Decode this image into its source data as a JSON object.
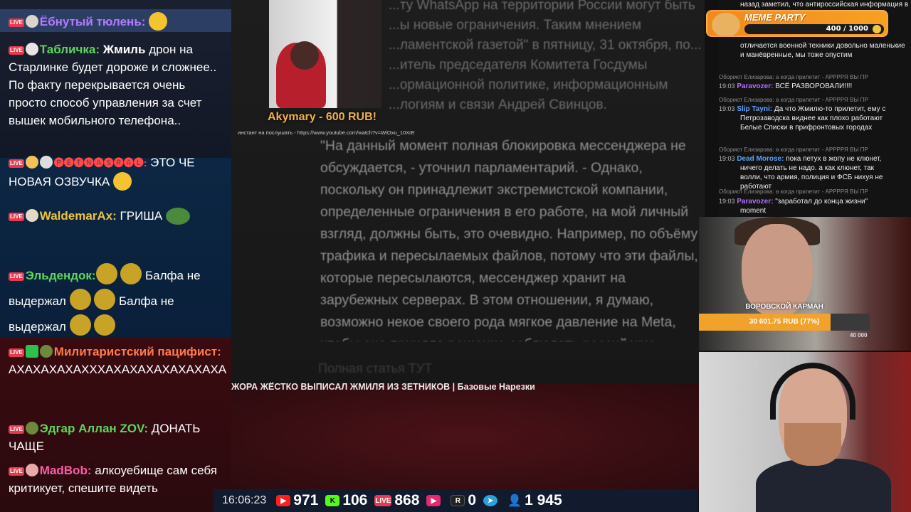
{
  "article": {
    "intro": "...ту WhatsApp на территории России могут быть ...ы новые ограничения. Таким мнением ...ламентской газетой\" в пятницу, 31 октября, по... ...итель председателя Комитета Госдумы ...ормационной политике, информационным ...логиям и связи Андрей Свинцов.",
    "quote": "\"На данный момент полная блокировка мессенджера не обсуждается, - уточнил парламентарий. - Однако, поскольку он принадлежит экстремистской компании, определенные ограничения в его работе, на мой личный взгляд, должны быть, это очевидно. Например, по объёму трафика и пересылаемых файлов, потому что эти файлы, которые пересылаются, мессенджер хранит на зарубежных серверах. В этом отношении, я думаю, возможно некое своего рода мягкое давление на Meta, чтобы она приняла решение соблюдать российские законы",
    "full_link": "Полная статья ТУТ"
  },
  "donation": {
    "title": "Akymary - 600 RUB!",
    "link": "инстант на послушать - https://www.youtube.com/watch?v=WiOxu_10XrE"
  },
  "chat": [
    {
      "nick": "Ёбнутый тюлень:",
      "text": "",
      "color": "#b47aff"
    },
    {
      "nick": "Табличка:",
      "text": " Жмиль дрон на Старлинке будет дороже и сложнее.. По факту перекрывается очень просто способ управления за счет вышек мобильного телефона..",
      "bold_prefix": "Жмиль",
      "color": "#5cd65c"
    },
    {
      "nick": "🅟🅔🅣🅝🅐🅢🅡🅐🅛:",
      "text": " ЭТО ЧЕ НОВАЯ ОЗВУЧКА",
      "color": "#ff4a4a"
    },
    {
      "nick": "WaldemarAx:",
      "text": " ГРИША",
      "color": "#f0c33c"
    },
    {
      "nick": "Эльдендок:",
      "text": " Балфа не выдержал  Балфа не выдержал",
      "color": "#5cd65c"
    },
    {
      "nick": "Милитаристский пацифист:",
      "text": " АХАХАХАХАХХХАХАХАХАХАХАХАХА",
      "color": "#ff7b4a"
    },
    {
      "nick": "Эдгар Аллан ZOV:",
      "text": " ДОНАТЬ ЧАЩЕ",
      "color": "#5cd65c"
    },
    {
      "nick": "MadBob:",
      "text": " алкоуебище сам себя критикует, спешите видеть",
      "color": "#ff5ca8"
    }
  ],
  "banner": {
    "title": "ЖОРА ЖЁСТКО ВЫПИСАЛ ЖМИЛЯ ИЗ ЗЕТНИКОВ | Базовые Нарезки"
  },
  "stats": {
    "time": "16:06:23",
    "youtube": "971",
    "kick": "106",
    "vk": "868",
    "rutube_play": "",
    "rumble": "0",
    "telegram": "",
    "viewers": "1 945",
    "colors": {
      "youtube": "#ff1f1f",
      "kick": "#53fc18",
      "vk": "#e53a4f",
      "rutube": "#e8286e",
      "telegram": "#2aa3dc",
      "viewers": "#6fb7ff"
    }
  },
  "rchat": {
    "top": "назад заметил, что антироссийская информация в социальных сетях имеет",
    "meme_title": "MEME PARTY",
    "meme_count": "400 / 1000",
    "meme_progress": 0.4,
    "cont": "отличается военной техники довольно маленькие и манёвренные, мы тоже опустим",
    "r1": "Обормот Елизарова: а когда прилетит - АРРРРЯ ВЫ ПР",
    "t1": "19:03",
    "n1": "Paravozer:",
    "m1": " ВСЁ РАЗВОРОВАЛИ!!!!",
    "r2": "Обормот Елизарова: а когда прилетит - АРРРРЯ ВЫ ПР",
    "t2": "19:03",
    "n2": "Slip Tayni:",
    "m2": " Да что Жмилю-то прилетит, ему с Петрозаводска виднее как плохо работают Белые Списки в прифронтовых городах",
    "r3": "Обормот Елизарова: а когда прилетит - АРРРРЯ ВЫ ПР",
    "t3": "19:03",
    "n3": "Dead Morose:",
    "m3": " пока петух в жопу не клюнет, ничего делать не надо. а как клюнет, так волли, что армия, полиция и ФСБ нихуя не работают",
    "r4": "Обормот Елизарова: а когда прилетит - АРРРРЯ ВЫ ПР",
    "t4": "19:03",
    "n4": "Paravozer:",
    "m4": " \"заработал до конца жизни\" moment"
  },
  "goal": {
    "label": "ВОРОВСКОЙ КАРМАН",
    "amount": "30 601.75 RUB (77%)",
    "progress": 0.77,
    "min": "",
    "max": "40 000"
  }
}
